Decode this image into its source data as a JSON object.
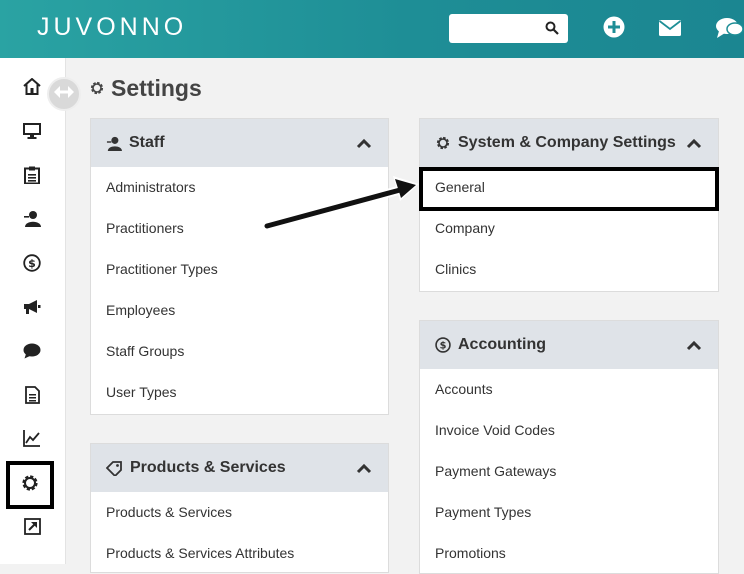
{
  "app": {
    "logo_text": "JUVONNO"
  },
  "header": {
    "search": {
      "value": "",
      "placeholder": ""
    },
    "icons": [
      "search-icon",
      "plus-circle-icon",
      "envelope-icon",
      "chat-icon"
    ]
  },
  "sidebar": {
    "items": [
      {
        "icon": "home-icon"
      },
      {
        "icon": "monitor-icon"
      },
      {
        "icon": "clipboard-icon"
      },
      {
        "icon": "staff-icon"
      },
      {
        "icon": "dollar-icon"
      },
      {
        "icon": "megaphone-icon"
      },
      {
        "icon": "chat-bubble-icon"
      },
      {
        "icon": "document-icon"
      },
      {
        "icon": "chart-icon"
      },
      {
        "icon": "gear-icon",
        "active": true
      },
      {
        "icon": "external-link-icon"
      }
    ]
  },
  "page": {
    "title": "Settings"
  },
  "panels": {
    "staff": {
      "title": "Staff",
      "items": [
        "Administrators",
        "Practitioners",
        "Practitioner Types",
        "Employees",
        "Staff Groups",
        "User Types"
      ]
    },
    "products": {
      "title": "Products & Services",
      "items": [
        "Products & Services",
        "Products & Services Attributes"
      ]
    },
    "system": {
      "title": "System & Company Settings",
      "items": [
        "General",
        "Company",
        "Clinics"
      ]
    },
    "accounting": {
      "title": "Accounting",
      "items": [
        "Accounts",
        "Invoice Void Codes",
        "Payment Gateways",
        "Payment Types",
        "Promotions"
      ]
    }
  },
  "colors": {
    "topbar": "#1e8e96",
    "panel_header": "#dfe3e8",
    "annotation": "#000000"
  }
}
